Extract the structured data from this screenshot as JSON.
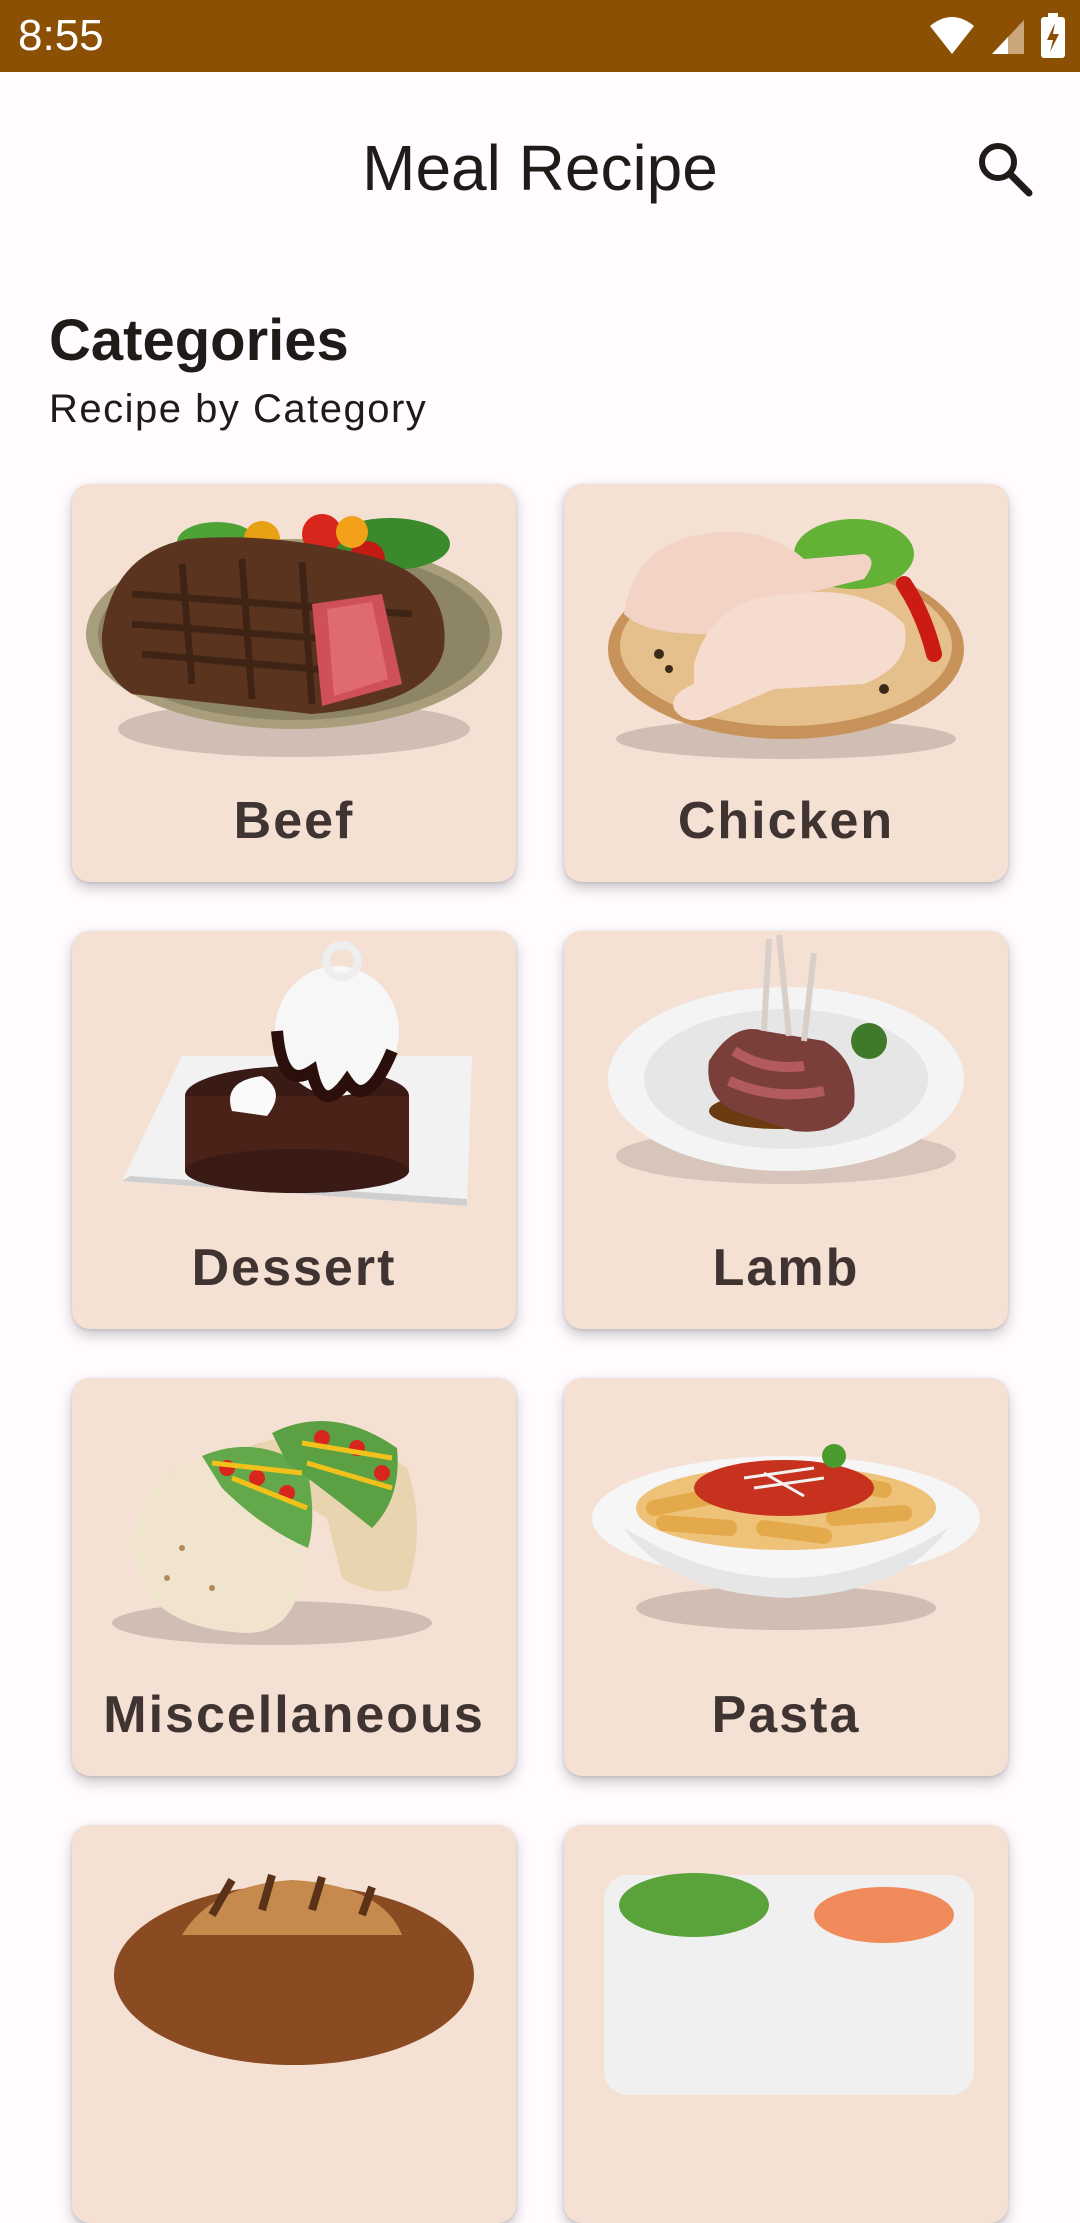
{
  "status_bar": {
    "time": "8:55",
    "icons": [
      "wifi-icon",
      "cellular-signal-icon",
      "battery-charging-icon"
    ]
  },
  "app_bar": {
    "title": "Meal Recipe",
    "search_icon": "search-icon"
  },
  "section": {
    "title": "Categories",
    "subtitle": "Recipe by Category"
  },
  "categories": [
    {
      "label": "Beef",
      "image": "steak-plate-image"
    },
    {
      "label": "Chicken",
      "image": "raw-chicken-board-image"
    },
    {
      "label": "Dessert",
      "image": "chocolate-cake-image"
    },
    {
      "label": "Lamb",
      "image": "lamb-chops-plate-image"
    },
    {
      "label": "Miscellaneous",
      "image": "tacos-image"
    },
    {
      "label": "Pasta",
      "image": "penne-pasta-bowl-image"
    },
    {
      "label": "",
      "image": "grilled-pork-image"
    },
    {
      "label": "",
      "image": "seafood-salad-image"
    }
  ],
  "colors": {
    "status_bar": "#8b5003",
    "card_background": "#f5e0d4",
    "card_label": "#3f3431",
    "background": "#fffbff"
  }
}
